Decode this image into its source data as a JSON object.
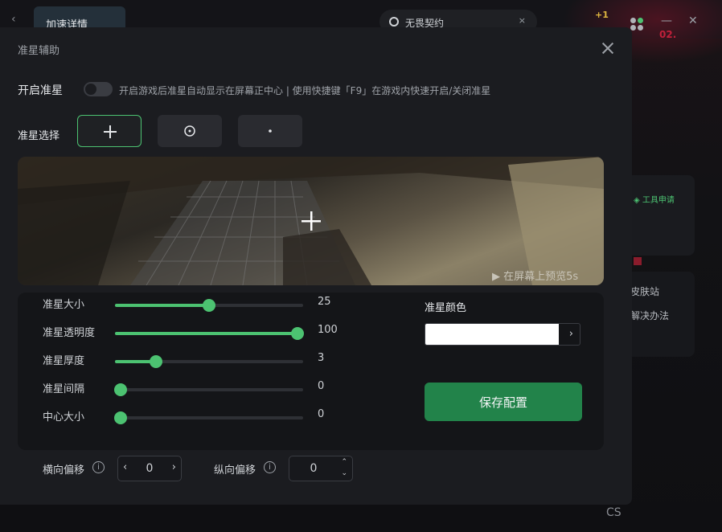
{
  "background": {
    "tab_label": "加速详情",
    "search_text": "无畏契约",
    "tool_apply": "工具申请",
    "skin_site": "皮肤站",
    "solve": "解决办法",
    "badge": "+1",
    "red_text": "02.",
    "watermark": "CS"
  },
  "dialog": {
    "title": "准星辅助",
    "toggle_label": "开启准星",
    "toggle_desc": "开启游戏后准星自动显示在屏幕正中心 | 使用快捷键「F9」在游戏内快速开启/关闭准星",
    "toggle_on": false,
    "select_label": "准星选择",
    "crosshair_options": [
      {
        "icon": "plus-crosshair-icon",
        "selected": true
      },
      {
        "icon": "circle-dot-crosshair-icon",
        "selected": false
      },
      {
        "icon": "dot-crosshair-icon",
        "selected": false
      }
    ],
    "preview_hint": "▶ 在屏幕上预览5s",
    "sliders": [
      {
        "label": "准星大小",
        "value": "25",
        "fraction": 0.5
      },
      {
        "label": "准星透明度",
        "value": "100",
        "fraction": 0.97
      },
      {
        "label": "准星厚度",
        "value": "3",
        "fraction": 0.22
      },
      {
        "label": "准星间隔",
        "value": "0",
        "fraction": 0.03
      },
      {
        "label": "中心大小",
        "value": "0",
        "fraction": 0.03
      }
    ],
    "color_label": "准星颜色",
    "color_value": "#ffffff",
    "save_label": "保存配置",
    "h_offset_label": "横向偏移",
    "h_offset_value": "0",
    "v_offset_label": "纵向偏移",
    "v_offset_value": "0",
    "accent": "#4cc271",
    "save_color": "#22834a"
  }
}
